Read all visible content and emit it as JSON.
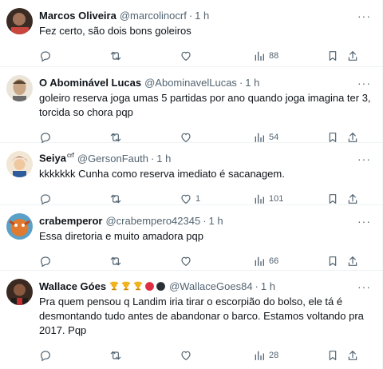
{
  "tweets": [
    {
      "name": "Marcos Oliveira",
      "name_suffix": "",
      "handle": "@marcolinocrf",
      "time": "1 h",
      "text": "Fez certo, são dois bons goleiros",
      "replies": "",
      "retweets": "",
      "likes": "",
      "views": "88"
    },
    {
      "name": "O Abominável Lucas",
      "name_suffix": "",
      "handle": "@AbominavelLucas",
      "time": "1 h",
      "text": "goleiro reserva joga umas 5 partidas por ano quando joga imagina ter 3,\ntorcida so chora pqp",
      "replies": "",
      "retweets": "",
      "likes": "",
      "views": "54"
    },
    {
      "name": "Seiya",
      "name_suffix": "crf",
      "handle": "@GersonFauth",
      "time": "1 h",
      "text": "kkkkkkk Cunha como reserva imediato é sacanagem.",
      "replies": "",
      "retweets": "",
      "likes": "1",
      "views": "101"
    },
    {
      "name": "crabemperor",
      "name_suffix": "",
      "handle": "@crabempero42345",
      "time": "1 h",
      "text": "Essa diretoria e muito amadora pqp",
      "replies": "",
      "retweets": "",
      "likes": "",
      "views": "66"
    },
    {
      "name": "Wallace Góes",
      "name_suffix": "",
      "handle": "@WallaceGoes84",
      "time": "1 h",
      "text": "Pra quem pensou q Landim iria tirar o escorpião do bolso, ele tá é\ndesmontando tudo antes de abandonar o barco. Estamos voltando pra\n2017. Pqp",
      "replies": "",
      "retweets": "",
      "likes": "",
      "views": "28",
      "badges": [
        "trophy-icon",
        "trophy-icon",
        "trophy-icon",
        "red-circle-icon",
        "black-circle-icon"
      ]
    }
  ],
  "ui": {
    "dot": "·",
    "more": "···"
  },
  "colors": {
    "text": "#0f1419",
    "muted": "#536471",
    "border": "#eff3f4"
  }
}
